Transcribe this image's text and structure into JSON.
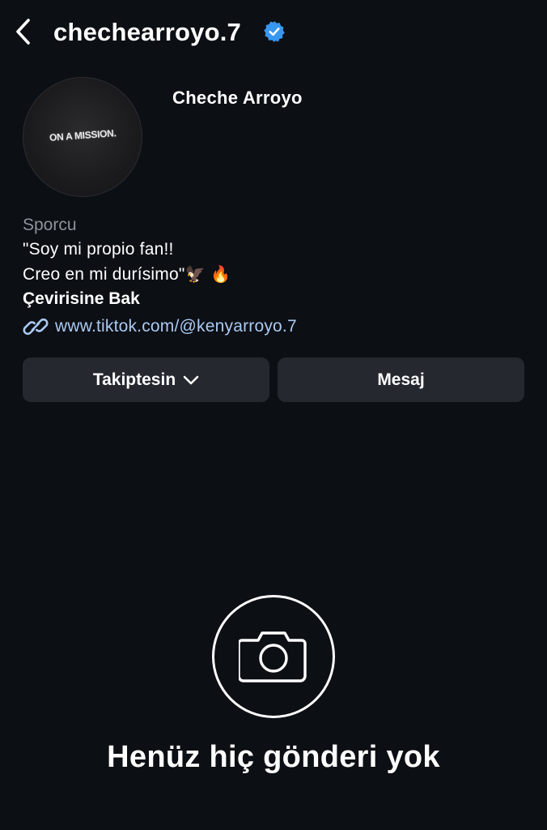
{
  "header": {
    "username": "chechearroyo.7",
    "back_icon": "chevron-left-icon",
    "verified_icon": "verified-badge-icon"
  },
  "profile": {
    "avatar_text": "ON A MISSION.",
    "display_name": "Cheche Arroyo",
    "category": "Sporcu",
    "bio_line1": "\"Soy mi propio fan!!",
    "bio_line2": "Creo en mi durísimo\"",
    "bio_emojis": "🦅 🔥",
    "translate_label": "Çevirisine Bak",
    "link_icon": "link-icon",
    "link": "www.tiktok.com/@kenyarroyo.7"
  },
  "actions": {
    "follow_label": "Takiptesin",
    "message_label": "Mesaj"
  },
  "empty_state": {
    "icon": "camera-icon",
    "text": "Henüz hiç gönderi yok"
  },
  "colors": {
    "background": "#0c0f14",
    "button_bg": "#25282e",
    "link": "#a9c9f2",
    "secondary_text": "#8e929a",
    "verified": "#3897f0"
  }
}
